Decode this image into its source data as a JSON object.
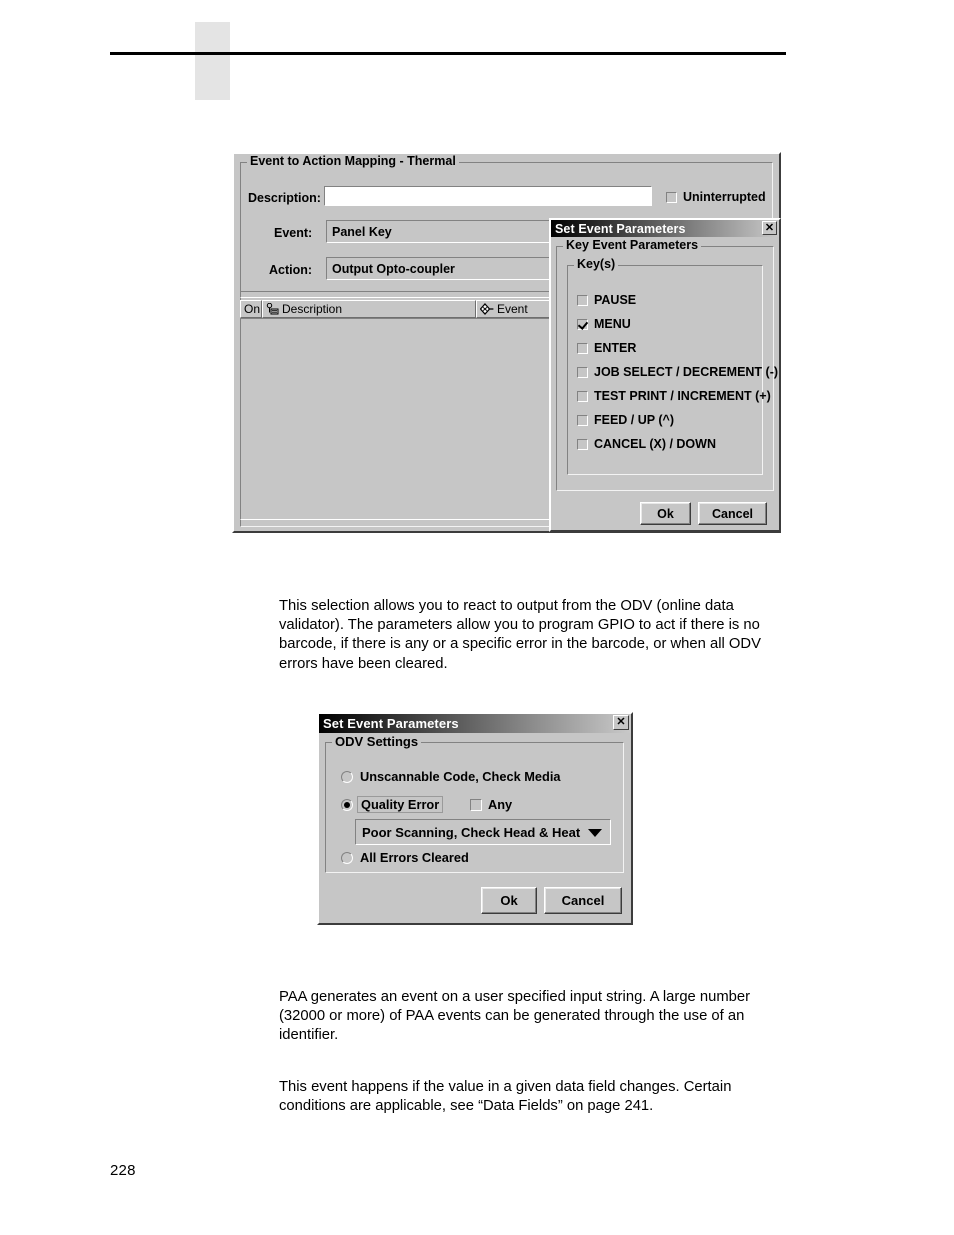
{
  "page": {
    "number": "228"
  },
  "paragraphs": {
    "odv": "This selection allows you to react to output from the ODV (online data validator). The parameters allow you to program GPIO to act if there is no barcode, if there is any or a specific error in the barcode, or when all ODV errors have been cleared.",
    "paa": "PAA generates an event on a user specified input string. A large number (32000 or more) of PAA events can be generated through the use of an identifier.",
    "datafield": "This event happens if the value in a given data field changes. Certain conditions are applicable, see “Data Fields” on page 241."
  },
  "main_dialog": {
    "group_title": "Event to Action Mapping - Thermal",
    "description_label": "Description:",
    "description_value": "",
    "description_placeholder": "",
    "uninterrupted_label": "Uninterrupted",
    "uninterrupted_checked": false,
    "event_label": "Event:",
    "event_value": "Panel Key",
    "action_label": "Action:",
    "action_value": "Output Opto-coupler",
    "list_columns": [
      {
        "label": "On",
        "icon": ""
      },
      {
        "label": "Description",
        "icon": "mapping-icon"
      },
      {
        "label": "Event",
        "icon": "diamond-icon"
      }
    ],
    "list_rows": []
  },
  "key_dialog": {
    "title": "Set Event Parameters",
    "close_label": "✕",
    "group_title": "Key Event Parameters",
    "keys_group_title": "Key(s)",
    "keys": [
      {
        "label": "PAUSE",
        "checked": false
      },
      {
        "label": "MENU",
        "checked": true
      },
      {
        "label": "ENTER",
        "checked": false
      },
      {
        "label": "JOB SELECT / DECREMENT (-)",
        "checked": false
      },
      {
        "label": "TEST PRINT / INCREMENT (+)",
        "checked": false
      },
      {
        "label": "FEED / UP (^)",
        "checked": false
      },
      {
        "label": "CANCEL (X) / DOWN",
        "checked": false
      }
    ],
    "ok_label": "Ok",
    "cancel_label": "Cancel"
  },
  "odv_dialog": {
    "title": "Set Event Parameters",
    "close_label": "✕",
    "group_title": "ODV Settings",
    "options": [
      {
        "label": "Unscannable Code, Check Media",
        "selected": false
      },
      {
        "label": "Quality Error",
        "selected": true
      },
      {
        "label": "All Errors Cleared",
        "selected": false
      }
    ],
    "any_label": "Any",
    "any_checked": false,
    "error_select_value": "Poor Scanning, Check Head & Heat",
    "ok_label": "Ok",
    "cancel_label": "Cancel"
  },
  "colors": {
    "window_face": "#c6c6c6",
    "titlebar_start": "#000000",
    "titlebar_end": "#c9c9c9",
    "header_tab": "#e4e4e4",
    "rule": "#000000"
  }
}
